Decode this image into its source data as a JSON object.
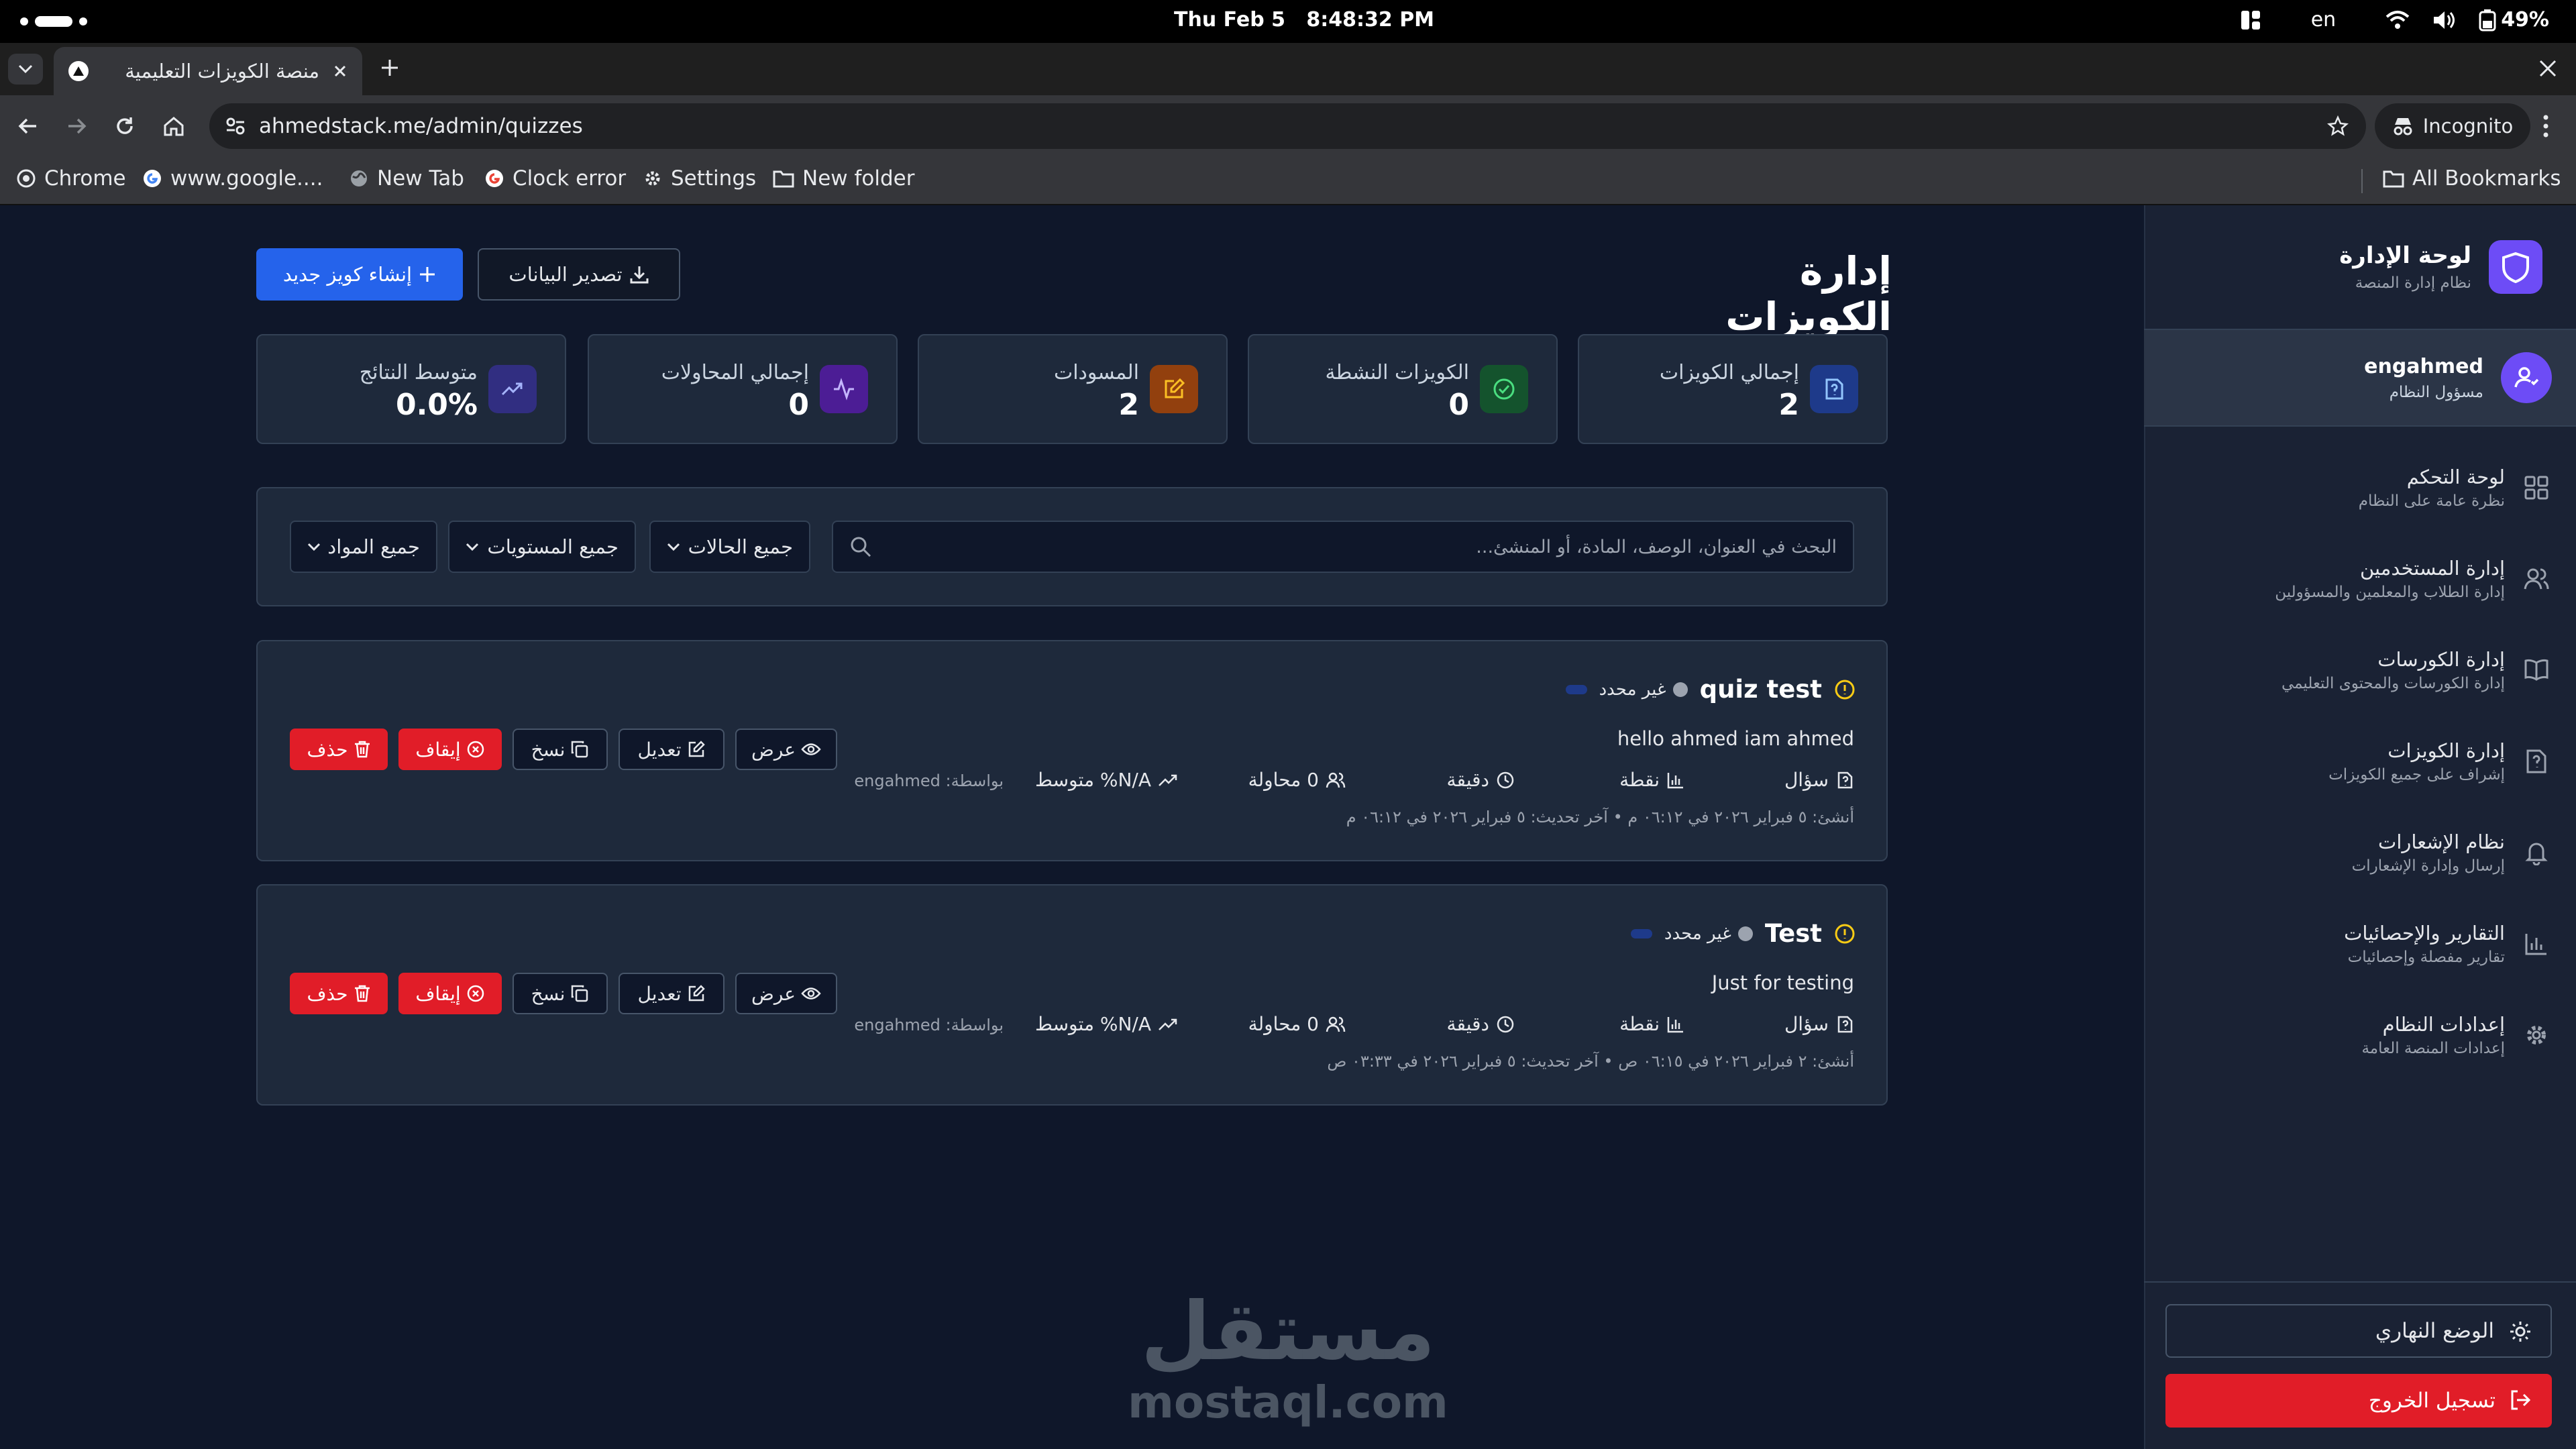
{
  "os": {
    "date": "Thu Feb 5",
    "time": "8:48:32 PM",
    "lang": "en",
    "battery": "49%"
  },
  "browser": {
    "tab_title": "منصة الكويزات التعليمية",
    "url": "ahmedstack.me/admin/quizzes",
    "incognito": "Incognito",
    "bookmarks": [
      "Chrome",
      "www.google....",
      "New Tab",
      "Clock error",
      "Settings",
      "New folder"
    ],
    "all_bookmarks": "All Bookmarks"
  },
  "sidebar": {
    "brand_title": "لوحة الإدارة",
    "brand_sub": "نظام إدارة المنصة",
    "user_name": "engahmed",
    "user_role": "مسؤول النظام",
    "items": [
      {
        "label": "لوحة التحكم",
        "sub": "نظرة عامة على النظام"
      },
      {
        "label": "إدارة المستخدمين",
        "sub": "إدارة الطلاب والمعلمين والمسؤولين"
      },
      {
        "label": "إدارة الكورسات",
        "sub": "إدارة الكورسات والمحتوى التعليمي"
      },
      {
        "label": "إدارة الكويزات",
        "sub": "إشراف على جميع الكويزات"
      },
      {
        "label": "نظام الإشعارات",
        "sub": "إرسال وإدارة الإشعارات"
      },
      {
        "label": "التقارير والإحصائيات",
        "sub": "تقارير مفصلة وإحصائيات"
      },
      {
        "label": "إعدادات النظام",
        "sub": "إعدادات المنصة العامة"
      }
    ],
    "day_mode": "الوضع النهاري",
    "logout": "تسجيل الخروج"
  },
  "page": {
    "title": "إدارة الكويزات",
    "export_btn": "تصدير البيانات",
    "create_btn": "إنشاء كويز جديد"
  },
  "stats": [
    {
      "label": "إجمالي الكويزات",
      "value": "2",
      "color": "#1e3a8a"
    },
    {
      "label": "الكويزات النشطة",
      "value": "0",
      "color": "#14532d"
    },
    {
      "label": "المسودات",
      "value": "2",
      "color": "#92400e"
    },
    {
      "label": "إجمالي المحاولات",
      "value": "0",
      "color": "#4c1d95"
    },
    {
      "label": "متوسط النتائج",
      "value": "0.0%",
      "color": "#312e81"
    }
  ],
  "filters": {
    "search_placeholder": "البحث في العنوان، الوصف، المادة، أو المنشئ...",
    "status": "جميع الحالات",
    "levels": "جميع المستويات",
    "subjects": "جميع المواد"
  },
  "quizzes": [
    {
      "title": "quiz test",
      "badge": "غير محدد",
      "desc": "hello ahmed iam ahmed",
      "questions": "سؤال",
      "points": "نقطة",
      "minutes": "دقيقة",
      "attempts": "0 محاولة",
      "avg": "N/A% متوسط",
      "by": "بواسطة: engahmed",
      "dates": "أنشئ: ٥ فبراير ٢٠٢٦ في ٠٦:١٢ م • آخر تحديث: ٥ فبراير ٢٠٢٦ في ٠٦:١٢ م"
    },
    {
      "title": "Test",
      "badge": "غير محدد",
      "desc": "Just for testing",
      "questions": "سؤال",
      "points": "نقطة",
      "minutes": "دقيقة",
      "attempts": "0 محاولة",
      "avg": "N/A% متوسط",
      "by": "بواسطة: engahmed",
      "dates": "أنشئ: ٢ فبراير ٢٠٢٦ في ٠٦:١٥ ص • آخر تحديث: ٥ فبراير ٢٠٢٦ في ٠٣:٣٣ ص"
    }
  ],
  "actions": {
    "view": "عرض",
    "edit": "تعديل",
    "copy": "نسخ",
    "stop": "إيقاف",
    "delete": "حذف"
  },
  "watermark": {
    "ar": "مستقل",
    "en": "mostaql.com"
  }
}
